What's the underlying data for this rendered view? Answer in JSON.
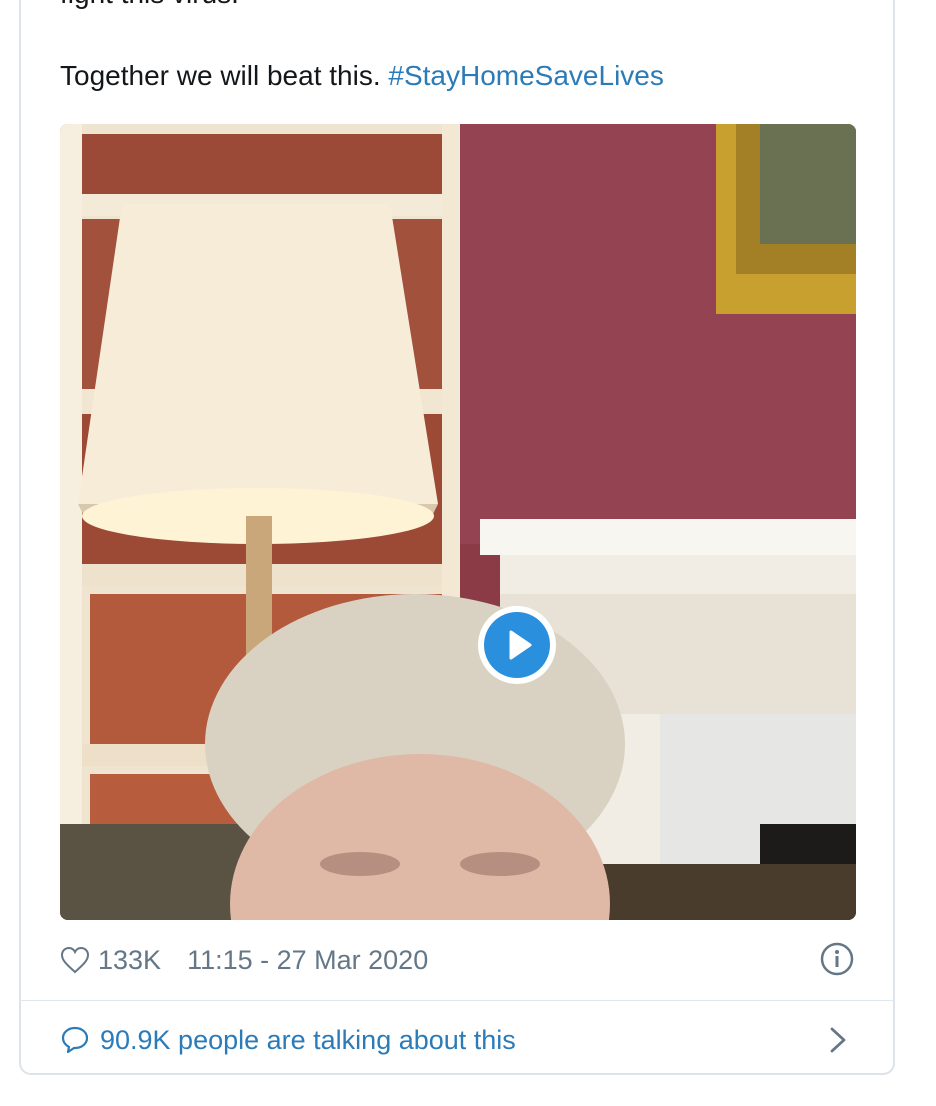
{
  "tweet": {
    "text_cut_line": "fight this virus.",
    "text_main": "Together we will beat this. ",
    "hashtag": "#StayHomeSaveLives"
  },
  "media": {
    "type": "video",
    "play_icon": "play-icon"
  },
  "meta": {
    "like_icon": "heart-icon",
    "likes": "133K",
    "timestamp": "11:15 - 27 Mar 2020",
    "info_icon": "info-icon"
  },
  "footer": {
    "comment_icon": "speech-bubble-icon",
    "talking": "90.9K people are talking about this",
    "chevron_icon": "chevron-right-icon"
  },
  "colors": {
    "link": "#2b7bb9",
    "text": "#14171a",
    "secondary": "#657786",
    "play_accent": "#2a8fdd"
  }
}
